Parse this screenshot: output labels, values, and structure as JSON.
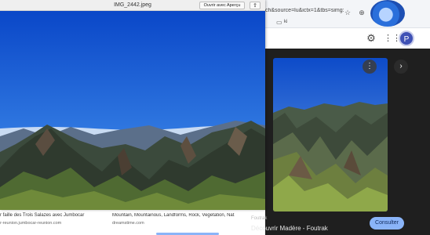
{
  "browser": {
    "url": "ch&source=lu&ictx=1&tbs=simg:C",
    "bookmark_folder": "ki",
    "avatar_initial": "P"
  },
  "preview": {
    "filename": "IMG_2442.jpeg",
    "open_with_label": "Ouvrir avec Aperçu",
    "share_icon": "share-icon"
  },
  "viewer": {
    "source": "Foutrak",
    "title": "Découvrir Madère - Foutrak",
    "visit_label": "Consulter"
  },
  "results": [
    {
      "title": "r faille des Trois Salazes avec Jumbocar",
      "site": "r-reunion.jumbocar-reunion.com"
    },
    {
      "title": "Mountain, Mountainous, Landforms, Rock, Vegetation, Nat...",
      "site": "dreamstime.com"
    }
  ],
  "colors": {
    "accent": "#8ab4f8",
    "avatar": "#3f51b5",
    "sky": "#1f5fd6"
  }
}
